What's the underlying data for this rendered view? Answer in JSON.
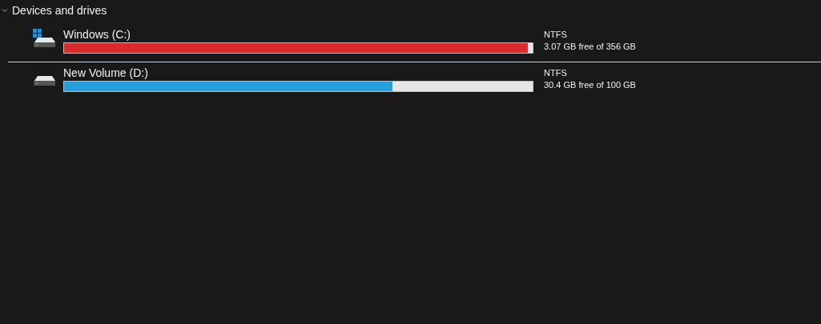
{
  "section": {
    "title": "Devices and drives",
    "expanded": true
  },
  "drives": [
    {
      "name": "Windows (C:)",
      "system": true,
      "level": 0.99,
      "color": "#da2a2a",
      "filesystem": "NTFS",
      "space": "3.07 GB free of 356 GB",
      "selected": true
    },
    {
      "name": "New Volume (D:)",
      "system": false,
      "level": 0.7,
      "color": "#26a0da",
      "filesystem": "NTFS",
      "space": "30.4 GB free of 100 GB",
      "selected": false
    }
  ]
}
